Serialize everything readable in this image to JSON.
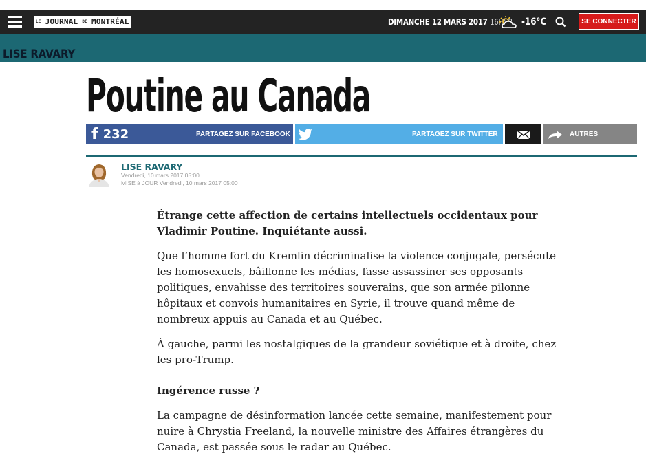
{
  "header": {
    "logo_small_1": "LE",
    "logo_word_1": "JOURNAL",
    "logo_small_2": "DE",
    "logo_word_2": "MONTRÉAL",
    "date": "DIMANCHE 12 MARS 2017",
    "time": "16H58",
    "temperature": "-16°C",
    "connect_label": "SE CONNECTER"
  },
  "section": {
    "author_band": "LISE RAVARY"
  },
  "article": {
    "title": "Poutine au Canada",
    "author": "LISE RAVARY",
    "published": "Vendredi, 10 mars 2017 05:00",
    "updated": "MISE à JOUR Vendredi, 10 mars 2017 05:00",
    "lead": "Étrange cette affection de certains intellectuels occidentaux pour Vladimir Poutine. Inquiétante aussi.",
    "paragraph_1": "Que l’homme fort du Kremlin décriminalise la violence conjugale, persécute les homosexuels, bâillonne les médias, fasse assassiner ses opposants politiques, envahisse des territoires souverains, que son armée pilonne hôpitaux et convois humanitaires en Syrie, il trouve quand même de nombreux appuis au Canada et au Québec.",
    "paragraph_2": "À gauche, parmi les nostalgiques de la grandeur soviétique et à droite, chez les pro-Trump.",
    "subheading": "Ingérence russe ?",
    "paragraph_3": "La campagne de désinformation lancée cette semaine, manifestement pour nuire à Chrystia Freeland, la nouvelle ministre des Affaires étrangères du Canada, est passée sous le radar au Québec."
  },
  "share": {
    "facebook_count": "232",
    "facebook_label": "PARTAGEZ SUR FACEBOOK",
    "twitter_label": "PARTAGEZ SUR TWITTER",
    "other_label": "AUTRES"
  },
  "icons": {
    "menu": "hamburger-icon",
    "weather": "partly-cloudy-icon",
    "search": "search-icon",
    "facebook": "facebook-icon",
    "twitter": "twitter-icon",
    "email": "envelope-icon",
    "share_other": "share-arrow-icon"
  },
  "colors": {
    "top_bar": "#232323",
    "author_band": "#1c6873",
    "connect_button": "#d61b1b",
    "facebook": "#3b5998",
    "twitter": "#53aee6",
    "email": "#1a1a1a",
    "other": "#858585"
  }
}
